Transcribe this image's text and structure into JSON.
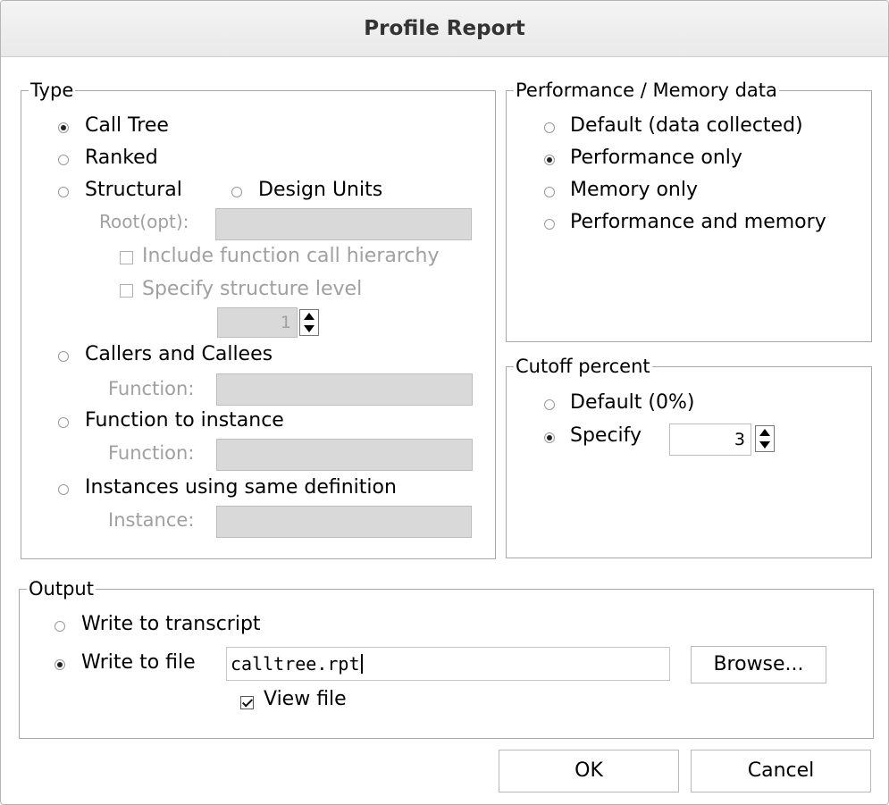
{
  "dialog": {
    "title": "Profile Report"
  },
  "type_group": {
    "legend": "Type",
    "call_tree": "Call Tree",
    "ranked": "Ranked",
    "structural": "Structural",
    "design_units": "Design Units",
    "root_label": "Root(opt):",
    "include_hierarchy": "Include function call hierarchy",
    "specify_level": "Specify structure level",
    "level_value": "1",
    "callers_callees": "Callers and Callees",
    "function_label_1": "Function:",
    "function_to_instance": "Function to instance",
    "function_label_2": "Function:",
    "instances_same_def": "Instances using same definition",
    "instance_label": "Instance:",
    "selected": "call_tree"
  },
  "perf_group": {
    "legend": "Performance / Memory data",
    "default": "Default (data collected)",
    "perf_only": "Performance only",
    "mem_only": "Memory only",
    "perf_and_mem": "Performance and memory",
    "selected": "perf_only"
  },
  "cutoff_group": {
    "legend": "Cutoff percent",
    "default": "Default (0%)",
    "specify": "Specify",
    "specify_value": "3",
    "selected": "specify"
  },
  "output_group": {
    "legend": "Output",
    "write_transcript": "Write to transcript",
    "write_file": "Write to file",
    "file_value": "calltree.rpt",
    "browse": "Browse...",
    "view_file": "View file",
    "view_file_checked": true,
    "selected": "write_file"
  },
  "buttons": {
    "ok": "OK",
    "cancel": "Cancel"
  }
}
